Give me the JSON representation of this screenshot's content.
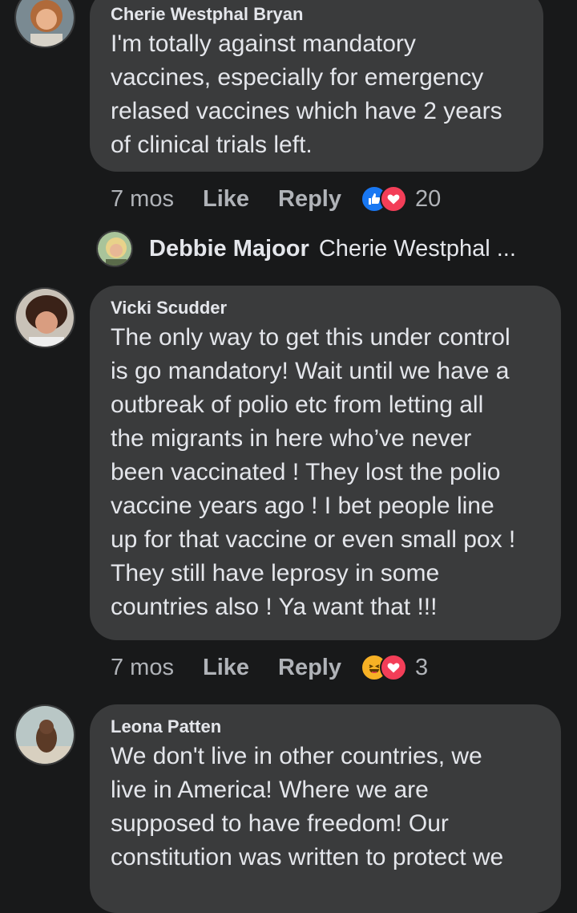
{
  "comments": [
    {
      "author": "Cherie Westphal Bryan",
      "text": "I'm totally against mandatory\nvaccines, especially for emergency\nrelased vaccines which have 2 years\nof clinical trials left.",
      "time": "7 mos",
      "like_label": "Like",
      "reply_label": "Reply",
      "reactions": [
        "like-icon",
        "love-icon"
      ],
      "reaction_count": "20"
    },
    {
      "author": "Vicki Scudder",
      "text": "The only way to get this under control\nis go mandatory! Wait until we have a\noutbreak of polio etc from letting all\nthe migrants in here who’ve never\nbeen vaccinated ! They lost the polio\nvaccine years ago ! I bet people line\nup for that vaccine or even small pox !\nThey still have leprosy in some\ncountries also ! Ya want that !!!",
      "time": "7 mos",
      "like_label": "Like",
      "reply_label": "Reply",
      "reactions": [
        "haha-icon",
        "love-icon"
      ],
      "reaction_count": "3"
    },
    {
      "author": "Leona Patten",
      "text": "We don't live in other countries, we\nlive in America! Where we are\nsupposed to have freedom! Our\nconstitution was written to protect we"
    }
  ],
  "reply_preview": {
    "author": "Debbie Majoor",
    "snippet": "Cherie Westphal ..."
  },
  "colors": {
    "background": "#18191a",
    "bubble": "#3a3b3c",
    "like_blue": "#1877f2",
    "love_red": "#f33e58",
    "haha_yellow": "#f7b125"
  }
}
